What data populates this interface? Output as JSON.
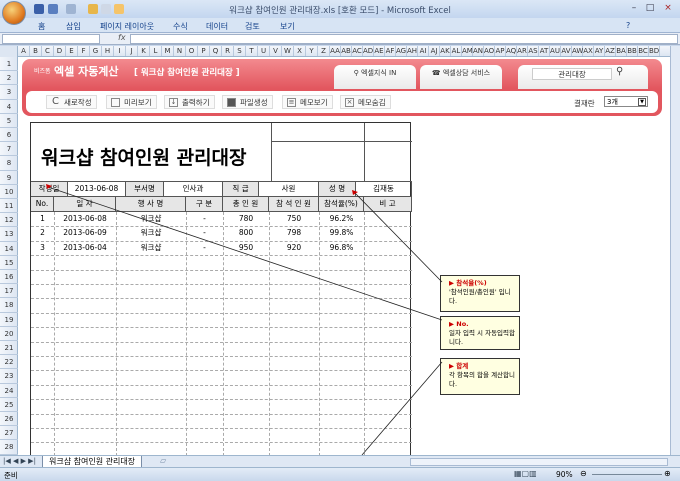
{
  "window": {
    "title": "워크샵 참여인원 관리대장.xls  [호환 모드] - Microsoft Excel"
  },
  "menu": [
    "홈",
    "삽입",
    "페이지 레이아웃",
    "수식",
    "데이터",
    "검토",
    "보기"
  ],
  "formula": {
    "fx": "fx"
  },
  "columns": [
    "A",
    "B",
    "C",
    "D",
    "E",
    "F",
    "G",
    "H",
    "I",
    "J",
    "K",
    "L",
    "M",
    "N",
    "O",
    "P",
    "Q",
    "R",
    "S",
    "T",
    "U",
    "V",
    "W",
    "X",
    "Y",
    "Z",
    "AA",
    "AB",
    "AC",
    "AD",
    "AE",
    "AF",
    "AG",
    "AH",
    "AI",
    "AJ",
    "AK",
    "AL",
    "AM",
    "AN",
    "AO",
    "AP",
    "AQ",
    "AR",
    "AS",
    "AT",
    "AU",
    "AV",
    "AW",
    "AX",
    "AY",
    "AZ",
    "BA",
    "BB",
    "BC",
    "BD"
  ],
  "addin": {
    "brand_small": "비즈폼",
    "brand": "엑셀 자동계산",
    "doc_title": "[ 워크샵 참여인원 관리대장 ]",
    "tabs": [
      "엑셀지식 IN",
      "엑셀상담 서비스"
    ],
    "search_value": "관리대장",
    "buttons": [
      "새로작성",
      "미리보기",
      "출력하기",
      "파일생성",
      "메모보기",
      "메모숨김"
    ],
    "approval_label": "결재란",
    "approval_value": "3개"
  },
  "doc": {
    "title": "워크샵 참여인원 관리대장",
    "info": [
      "작성일",
      "2013-06-08",
      "부서명",
      "인사과",
      "직 급",
      "사원",
      "성 명",
      "김재동"
    ],
    "headers": [
      "No.",
      "일    자",
      "행 사 명",
      "구 분",
      "총 인 원",
      "참 석 인 원",
      "참석율(%)",
      "비    고"
    ],
    "rows": [
      [
        "1",
        "2013-06-08",
        "워크샵",
        "-",
        "780",
        "750",
        "96.2%",
        ""
      ],
      [
        "2",
        "2013-06-09",
        "워크샵",
        "-",
        "800",
        "798",
        "99.8%",
        ""
      ],
      [
        "3",
        "2013-06-04",
        "워크샵",
        "-",
        "950",
        "920",
        "96.8%",
        ""
      ]
    ]
  },
  "notes": [
    {
      "title": "참석율(%)",
      "body": "'참석인원/총인원' 입니다."
    },
    {
      "title": "No.",
      "body": "일자 입력 시 자동입력합니다."
    },
    {
      "title": "합계",
      "body": "각 항목의 합을 계산합니다."
    }
  ],
  "sheet_tab": "워크샵 참여인원 관리대장",
  "status": {
    "ready": "준비",
    "zoom": "90%"
  }
}
